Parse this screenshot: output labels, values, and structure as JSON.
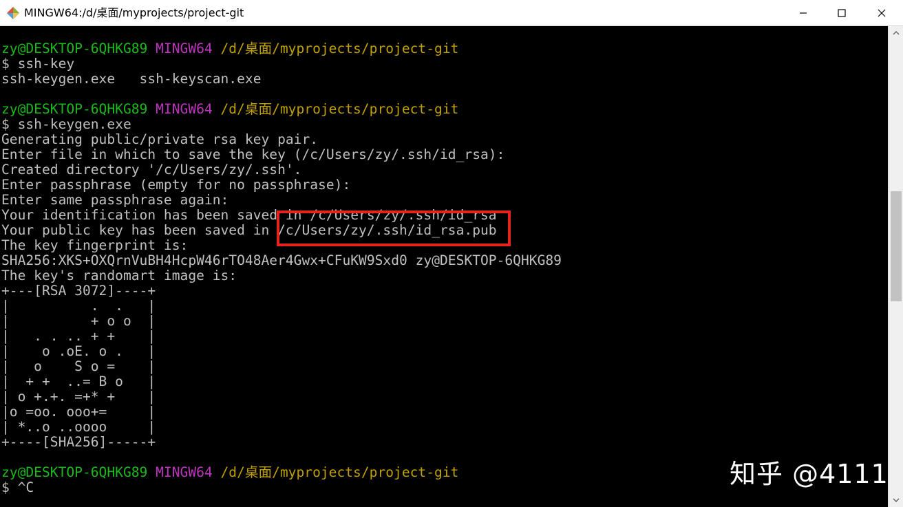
{
  "window": {
    "title": "MINGW64:/d/桌面/myprojects/project-git",
    "app_icon": "git-bash-icon",
    "controls": [
      "minimize-icon",
      "maximize-icon",
      "close-icon"
    ]
  },
  "terminal": {
    "colors": {
      "text": "#c0c0c0",
      "user_host": "#1cb81c",
      "shell": "#bd35bf",
      "path": "#c0a000",
      "highlight": "#e8231f",
      "background": "#000000"
    },
    "lines": [
      {
        "segments": [
          {
            "text": "zy@DESKTOP-6QHKG89",
            "style": "green"
          },
          {
            "text": " "
          },
          {
            "text": "MINGW64",
            "style": "purple"
          },
          {
            "text": " "
          },
          {
            "text": "/d/桌面/myprojects/project-git",
            "style": "yellow"
          }
        ]
      },
      {
        "segments": [
          {
            "text": "$ ssh-key"
          }
        ]
      },
      {
        "segments": [
          {
            "text": "ssh-keygen.exe   ssh-keyscan.exe"
          }
        ]
      },
      {
        "segments": [
          {
            "text": ""
          }
        ]
      },
      {
        "segments": [
          {
            "text": "zy@DESKTOP-6QHKG89",
            "style": "green"
          },
          {
            "text": " "
          },
          {
            "text": "MINGW64",
            "style": "purple"
          },
          {
            "text": " "
          },
          {
            "text": "/d/桌面/myprojects/project-git",
            "style": "yellow"
          }
        ]
      },
      {
        "segments": [
          {
            "text": "$ ssh-keygen.exe"
          }
        ]
      },
      {
        "segments": [
          {
            "text": "Generating public/private rsa key pair."
          }
        ]
      },
      {
        "segments": [
          {
            "text": "Enter file in which to save the key (/c/Users/zy/.ssh/id_rsa):"
          }
        ]
      },
      {
        "segments": [
          {
            "text": "Created directory '/c/Users/zy/.ssh'."
          }
        ]
      },
      {
        "segments": [
          {
            "text": "Enter passphrase (empty for no passphrase):"
          }
        ]
      },
      {
        "segments": [
          {
            "text": "Enter same passphrase again:"
          }
        ]
      },
      {
        "segments": [
          {
            "text": "Your identification has been saved in /c/Users/zy/.ssh/id_rsa"
          }
        ]
      },
      {
        "segments": [
          {
            "text": "Your public key has been saved in /c/Users/zy/.ssh/id_rsa.pub"
          }
        ]
      },
      {
        "segments": [
          {
            "text": "The key fingerprint is:"
          }
        ]
      },
      {
        "segments": [
          {
            "text": "SHA256:XKS+OXQrnVuBH4HcpW46rTO48Aer4Gwx+CFuKW9Sxd0 zy@DESKTOP-6QHKG89"
          }
        ]
      },
      {
        "segments": [
          {
            "text": "The key's randomart image is:"
          }
        ]
      },
      {
        "segments": [
          {
            "text": "+---[RSA 3072]----+"
          }
        ]
      },
      {
        "segments": [
          {
            "text": "|          .  .   |"
          }
        ]
      },
      {
        "segments": [
          {
            "text": "|          + o o  |"
          }
        ]
      },
      {
        "segments": [
          {
            "text": "|   . . .. + +    |"
          }
        ]
      },
      {
        "segments": [
          {
            "text": "|    o .oE. o .   |"
          }
        ]
      },
      {
        "segments": [
          {
            "text": "|   o    S o =    |"
          }
        ]
      },
      {
        "segments": [
          {
            "text": "|  + +  ..= B o   |"
          }
        ]
      },
      {
        "segments": [
          {
            "text": "| o +.+. =+* +    |"
          }
        ]
      },
      {
        "segments": [
          {
            "text": "|o =oo. ooo+=     |"
          }
        ]
      },
      {
        "segments": [
          {
            "text": "| *..o ..oooo     |"
          }
        ]
      },
      {
        "segments": [
          {
            "text": "+----[SHA256]-----+"
          }
        ]
      },
      {
        "segments": [
          {
            "text": ""
          }
        ]
      },
      {
        "segments": [
          {
            "text": "zy@DESKTOP-6QHKG89",
            "style": "green"
          },
          {
            "text": " "
          },
          {
            "text": "MINGW64",
            "style": "purple"
          },
          {
            "text": " "
          },
          {
            "text": "/d/桌面/myprojects/project-git",
            "style": "yellow"
          }
        ]
      },
      {
        "segments": [
          {
            "text": "$ ^C"
          }
        ]
      }
    ]
  },
  "watermark": "知乎 @4111"
}
